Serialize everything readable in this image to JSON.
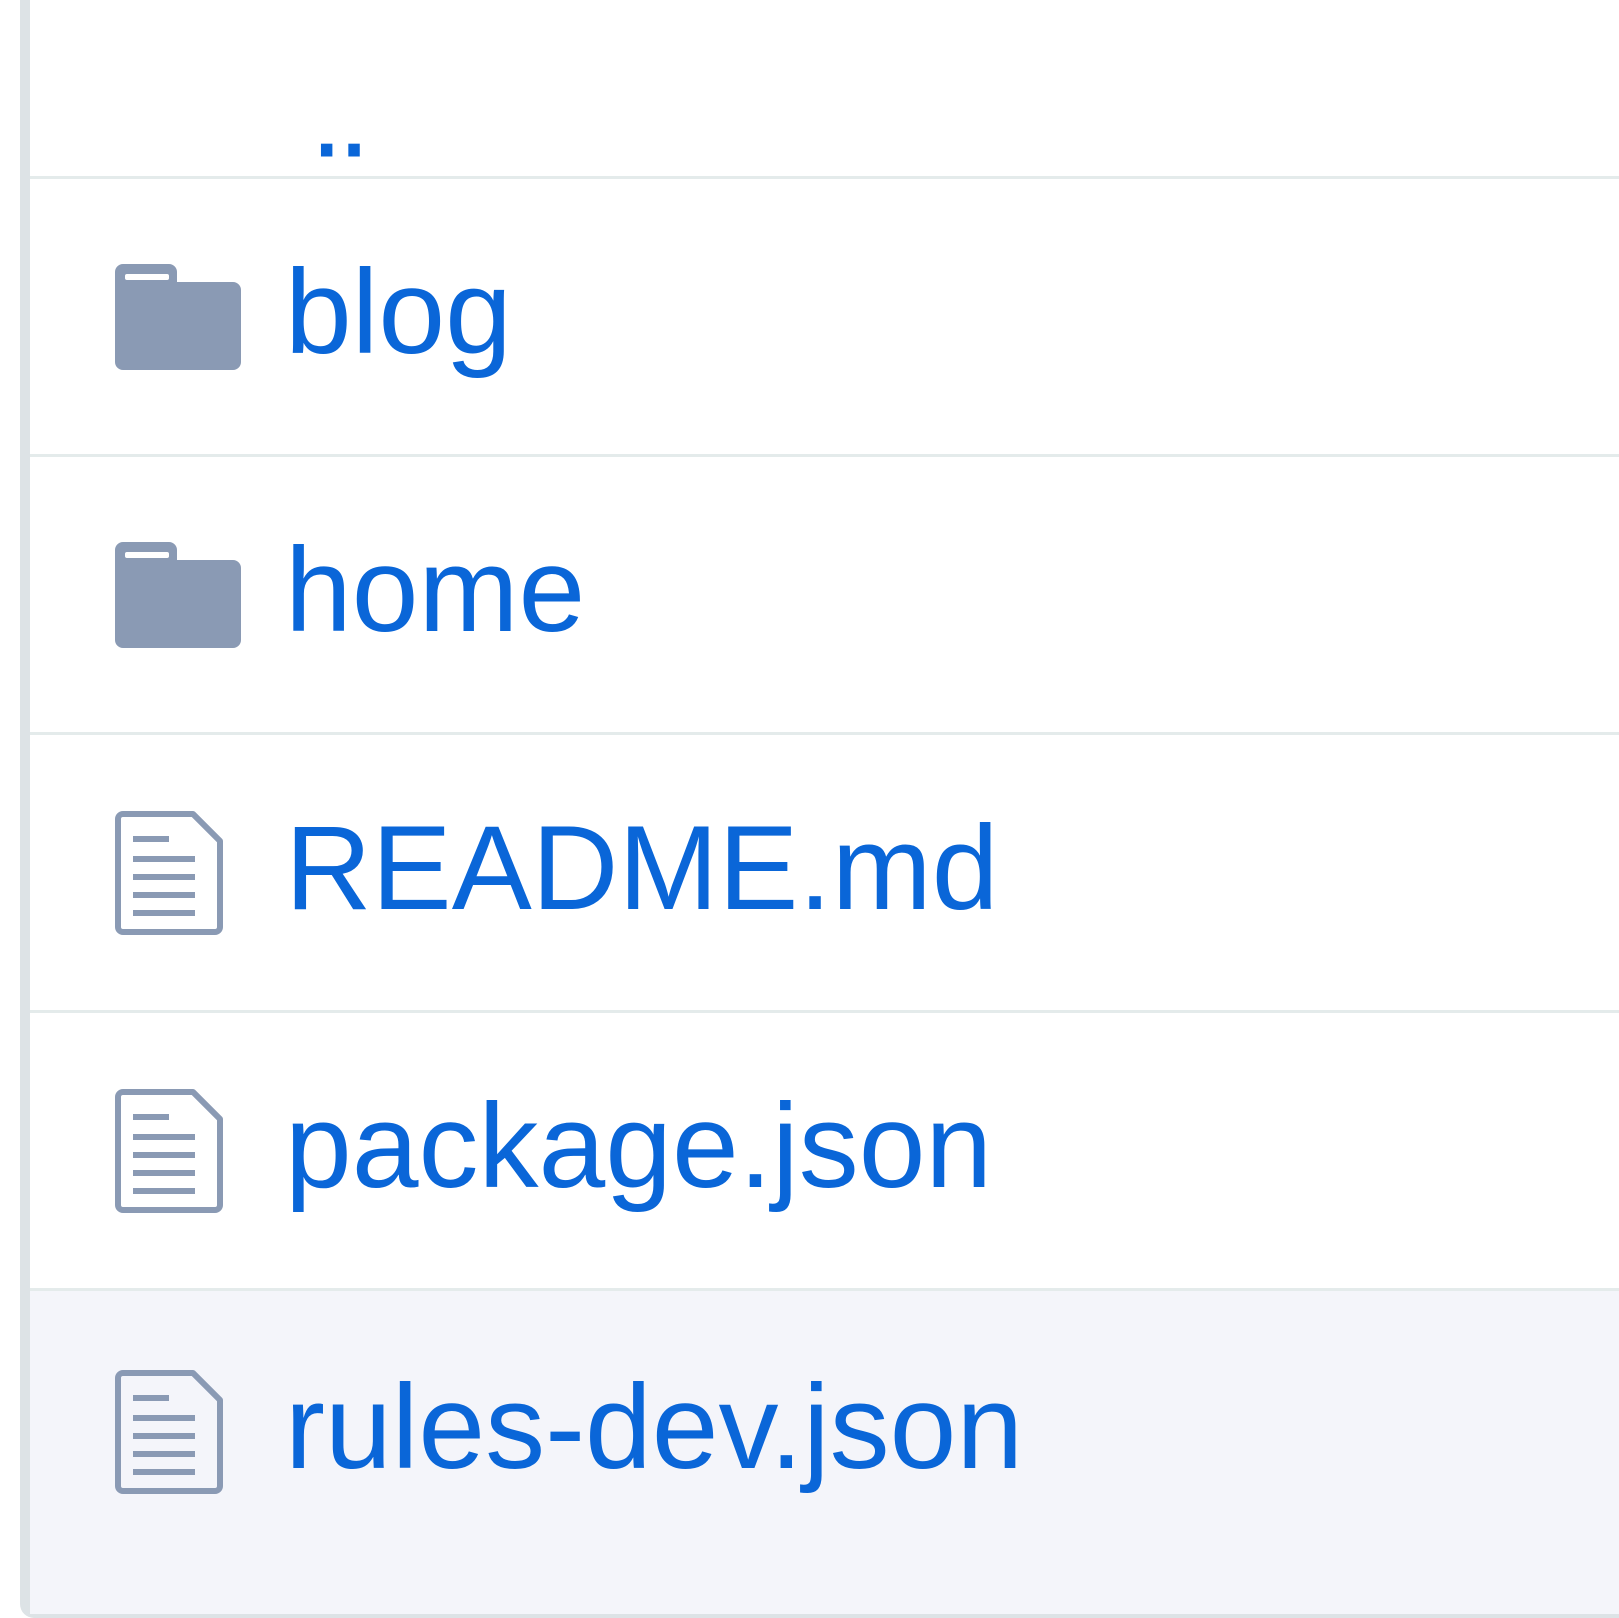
{
  "file_list": {
    "parent_label": "..",
    "items": [
      {
        "name": "blog",
        "type": "folder",
        "icon": "folder-icon"
      },
      {
        "name": "home",
        "type": "folder",
        "icon": "folder-icon"
      },
      {
        "name": "README.md",
        "type": "file",
        "icon": "file-text-icon"
      },
      {
        "name": "package.json",
        "type": "file",
        "icon": "file-text-icon"
      },
      {
        "name": "rules-dev.json",
        "type": "file",
        "icon": "file-text-icon"
      }
    ]
  },
  "colors": {
    "link": "#0a66d8",
    "icon": "#8a9ab4",
    "row_border": "#e4ebeb",
    "row_hover": "#f4f5fa"
  }
}
